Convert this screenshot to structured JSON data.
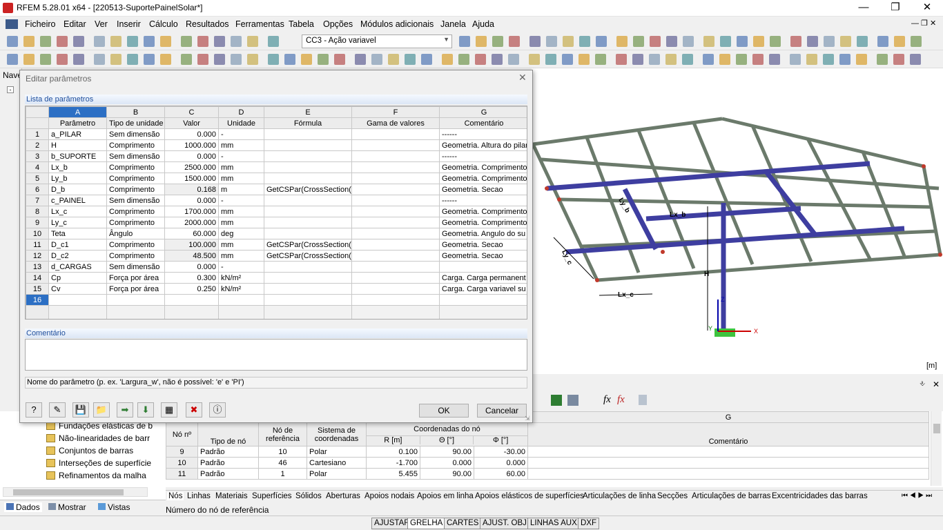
{
  "window": {
    "title": "RFEM 5.28.01 x64 - [220513-SuportePainelSolar*]"
  },
  "menu": [
    "Ficheiro",
    "Editar",
    "Ver",
    "Inserir",
    "Cálculo",
    "Resultados",
    "Ferramentas",
    "Tabela",
    "Opções",
    "Módulos adicionais",
    "Janela",
    "Ajuda"
  ],
  "loadcase": "CC3 - Ação variavel",
  "left_panel_label": "Nave",
  "dialog": {
    "title": "Editar parâmetros",
    "section_params": "Lista de parâmetros",
    "col_letters": [
      "A",
      "B",
      "C",
      "D",
      "E",
      "F",
      "G"
    ],
    "col_headers": [
      "Parâmetro",
      "Tipo de unidade",
      "Valor",
      "Unidade",
      "Fórmula",
      "Gama de valores",
      "Comentário"
    ],
    "rows": [
      {
        "n": "1",
        "p": "a_PILAR",
        "t": "Sem dimensão",
        "v": "0.000",
        "u": "-",
        "f": "",
        "g": "",
        "c": "------"
      },
      {
        "n": "2",
        "p": "H",
        "t": "Comprimento",
        "v": "1000.000",
        "u": "mm",
        "f": "",
        "g": "",
        "c": "Geometria. Altura do pilar"
      },
      {
        "n": "3",
        "p": "b_SUPORTE",
        "t": "Sem dimensão",
        "v": "0.000",
        "u": "-",
        "f": "",
        "g": "",
        "c": "------"
      },
      {
        "n": "4",
        "p": "Lx_b",
        "t": "Comprimento",
        "v": "2500.000",
        "u": "mm",
        "f": "",
        "g": "",
        "c": "Geometria. Comprimento"
      },
      {
        "n": "5",
        "p": "Ly_b",
        "t": "Comprimento",
        "v": "1500.000",
        "u": "mm",
        "f": "",
        "g": "",
        "c": "Geometria. Comprimento"
      },
      {
        "n": "6",
        "p": "D_b",
        "t": "Comprimento",
        "v": "0.168",
        "u": "m",
        "f": "GetCSPar(CrossSection(",
        "g": "",
        "c": "Geometria. Secao"
      },
      {
        "n": "7",
        "p": "c_PAINEL",
        "t": "Sem dimensão",
        "v": "0.000",
        "u": "-",
        "f": "",
        "g": "",
        "c": "------"
      },
      {
        "n": "8",
        "p": "Lx_c",
        "t": "Comprimento",
        "v": "1700.000",
        "u": "mm",
        "f": "",
        "g": "",
        "c": "Geometria. Comprimento"
      },
      {
        "n": "9",
        "p": "Ly_c",
        "t": "Comprimento",
        "v": "2000.000",
        "u": "mm",
        "f": "",
        "g": "",
        "c": "Geometria. Comprimento"
      },
      {
        "n": "10",
        "p": "Teta",
        "t": "Ângulo",
        "v": "60.000",
        "u": "deg",
        "f": "",
        "g": "",
        "c": "Geometria. Angulo do su"
      },
      {
        "n": "11",
        "p": "D_c1",
        "t": "Comprimento",
        "v": "100.000",
        "u": "mm",
        "f": "GetCSPar(CrossSection(",
        "g": "",
        "c": "Geometria. Secao"
      },
      {
        "n": "12",
        "p": "D_c2",
        "t": "Comprimento",
        "v": "48.500",
        "u": "mm",
        "f": "GetCSPar(CrossSection(",
        "g": "",
        "c": "Geometria. Secao"
      },
      {
        "n": "13",
        "p": "d_CARGAS",
        "t": "Sem dimensão",
        "v": "0.000",
        "u": "-",
        "f": "",
        "g": "",
        "c": ""
      },
      {
        "n": "14",
        "p": "Cp",
        "t": "Força por área",
        "v": "0.300",
        "u": "kN/m²",
        "f": "",
        "g": "",
        "c": "Carga. Carga permanent"
      },
      {
        "n": "15",
        "p": "Cv",
        "t": "Força por área",
        "v": "0.250",
        "u": "kN/m²",
        "f": "",
        "g": "",
        "c": "Carga. Carga variavel su"
      },
      {
        "n": "16",
        "p": "",
        "t": "",
        "v": "",
        "u": "",
        "f": "",
        "g": "",
        "c": ""
      }
    ],
    "section_comment": "Comentário",
    "hint": "Nome do parâmetro (p. ex. 'Largura_w', não é possível: 'e' e 'PI')",
    "ok": "OK",
    "cancel": "Cancelar"
  },
  "view3d": {
    "unit": "[m]",
    "labels": {
      "lyb": "Ly_b",
      "lxb": "Lx_b",
      "lyc": "Ly_c",
      "lxc": "Lx_c",
      "h": "H",
      "x": "X",
      "z": "Z",
      "y": "Y"
    }
  },
  "nav_items": [
    "Fundações elásticas de b",
    "Não-linearidades de barr",
    "Conjuntos de barras",
    "Interseções de superfície",
    "Refinamentos da malha"
  ],
  "nav_tabs": [
    "Dados",
    "Mostrar",
    "Vistas"
  ],
  "bottom_table": {
    "col_letter_g": "G",
    "headers": {
      "no": "Nó nº",
      "tipo": "Tipo de nó",
      "ref": "Nó de referência",
      "sis": "Sistema de coordenadas",
      "coords": "Coordenadas do nó",
      "r": "R [m]",
      "theta": "Θ [°]",
      "phi": "Φ [°]",
      "com": "Comentário"
    },
    "rows": [
      {
        "no": "9",
        "tipo": "Padrão",
        "ref": "10",
        "sis": "Polar",
        "r": "0.100",
        "theta": "90.00",
        "phi": "-30.00"
      },
      {
        "no": "10",
        "tipo": "Padrão",
        "ref": "46",
        "sis": "Cartesiano",
        "r": "-1.700",
        "theta": "0.000",
        "phi": "0.000"
      },
      {
        "no": "11",
        "tipo": "Padrão",
        "ref": "1",
        "sis": "Polar",
        "r": "5.455",
        "theta": "90.00",
        "phi": "60.00"
      }
    ]
  },
  "bottom_tabs": [
    "Nós",
    "Linhas",
    "Materiais",
    "Superfícies",
    "Sólidos",
    "Aberturas",
    "Apoios nodais",
    "Apoios em linha",
    "Apoios elásticos de superfícies",
    "Articulações de linha",
    "Secções",
    "Articulações de barras",
    "Excentricidades das barras"
  ],
  "bottom_status": "Número do nó de referência",
  "status": [
    "AJUSTAR",
    "GRELHA",
    "CARTES",
    "AJUST. OBJ.",
    "LINHAS AUX.",
    "DXF"
  ]
}
